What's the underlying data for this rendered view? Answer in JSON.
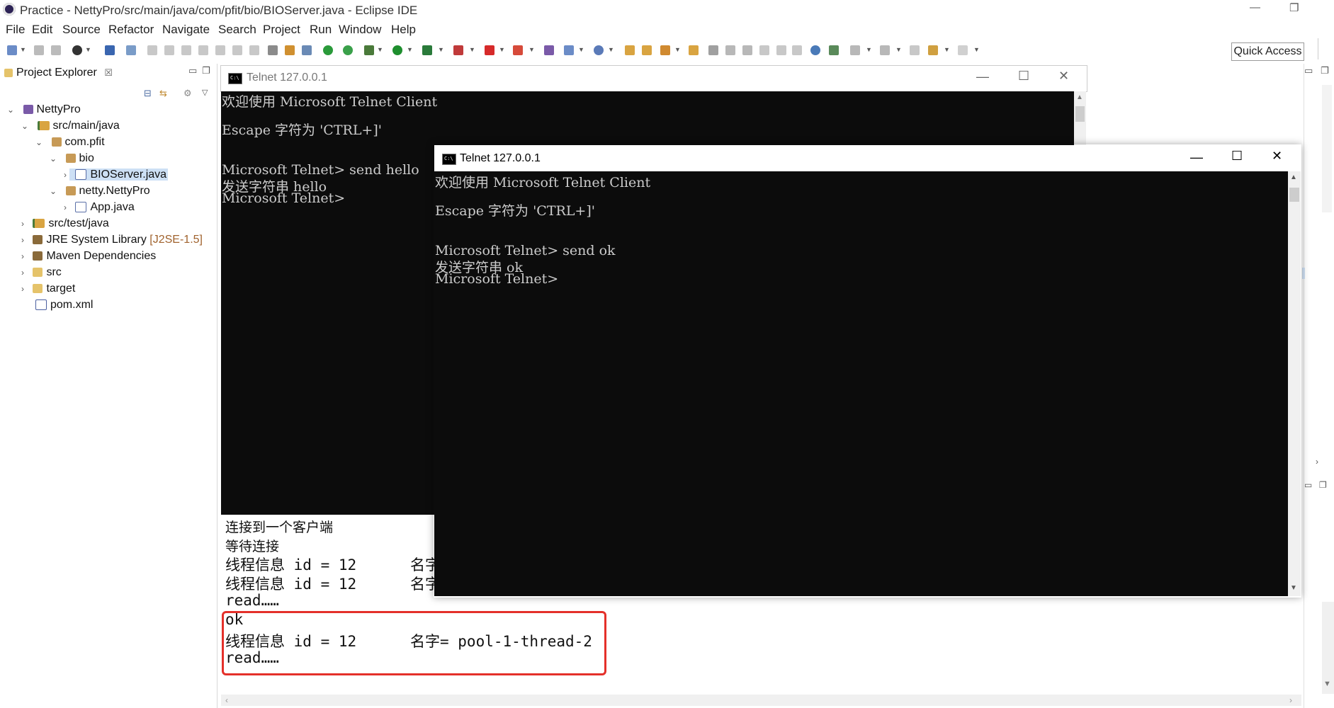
{
  "eclipse": {
    "title": "Practice - NettyPro/src/main/java/com/pfit/bio/BIOServer.java - Eclipse IDE",
    "window_controls": {
      "minimize": "—",
      "restore": "❐"
    },
    "menu": [
      "File",
      "Edit",
      "Source",
      "Refactor",
      "Navigate",
      "Search",
      "Project",
      "Run",
      "Window",
      "Help"
    ],
    "quick_access": "Quick Access"
  },
  "project_explorer": {
    "tab_label": "Project Explorer",
    "tab_close": "☒",
    "tree": [
      {
        "label": "NettyPro",
        "icon": "project-icon",
        "expanded": true
      },
      {
        "label": "src/main/java",
        "icon": "source-folder-icon",
        "expanded": true
      },
      {
        "label": "com.pfit",
        "icon": "package-icon",
        "expanded": true
      },
      {
        "label": "bio",
        "icon": "package-icon",
        "expanded": true
      },
      {
        "label": "BIOServer.java",
        "icon": "java-file-icon",
        "selected": true
      },
      {
        "label": "netty.NettyPro",
        "icon": "package-icon",
        "expanded": true
      },
      {
        "label": "App.java",
        "icon": "java-file-icon"
      },
      {
        "label": "src/test/java",
        "icon": "source-folder-icon"
      },
      {
        "label": "JRE System Library",
        "suffix": "[J2SE-1.5]",
        "icon": "library-icon"
      },
      {
        "label": "Maven Dependencies",
        "icon": "library-icon"
      },
      {
        "label": "src",
        "icon": "folder-icon"
      },
      {
        "label": "target",
        "icon": "folder-icon"
      },
      {
        "label": "pom.xml",
        "icon": "xml-file-icon"
      }
    ]
  },
  "telnet_back": {
    "title": "Telnet 127.0.0.1",
    "lines": [
      "欢迎使用 Microsoft Telnet Client",
      "",
      "Escape 字符为 'CTRL+]'",
      "",
      "",
      "Microsoft Telnet> send hello",
      "发送字符串 hello",
      "Microsoft Telnet>"
    ]
  },
  "telnet_front": {
    "title": "Telnet 127.0.0.1",
    "lines": [
      "欢迎使用 Microsoft Telnet Client",
      "",
      "Escape 字符为 'CTRL+]'",
      "",
      "",
      "Microsoft Telnet> send ok",
      "发送字符串 ok",
      "Microsoft Telnet>"
    ]
  },
  "console": {
    "lines": [
      "连接到一个客户端",
      "等待连接",
      "线程信息 id = 12      名字",
      "线程信息 id = 12      名字",
      "read……",
      "ok",
      "线程信息 id = 12      名字= pool-1-thread-2",
      "read……"
    ],
    "highlight_color": "#e4302a"
  }
}
